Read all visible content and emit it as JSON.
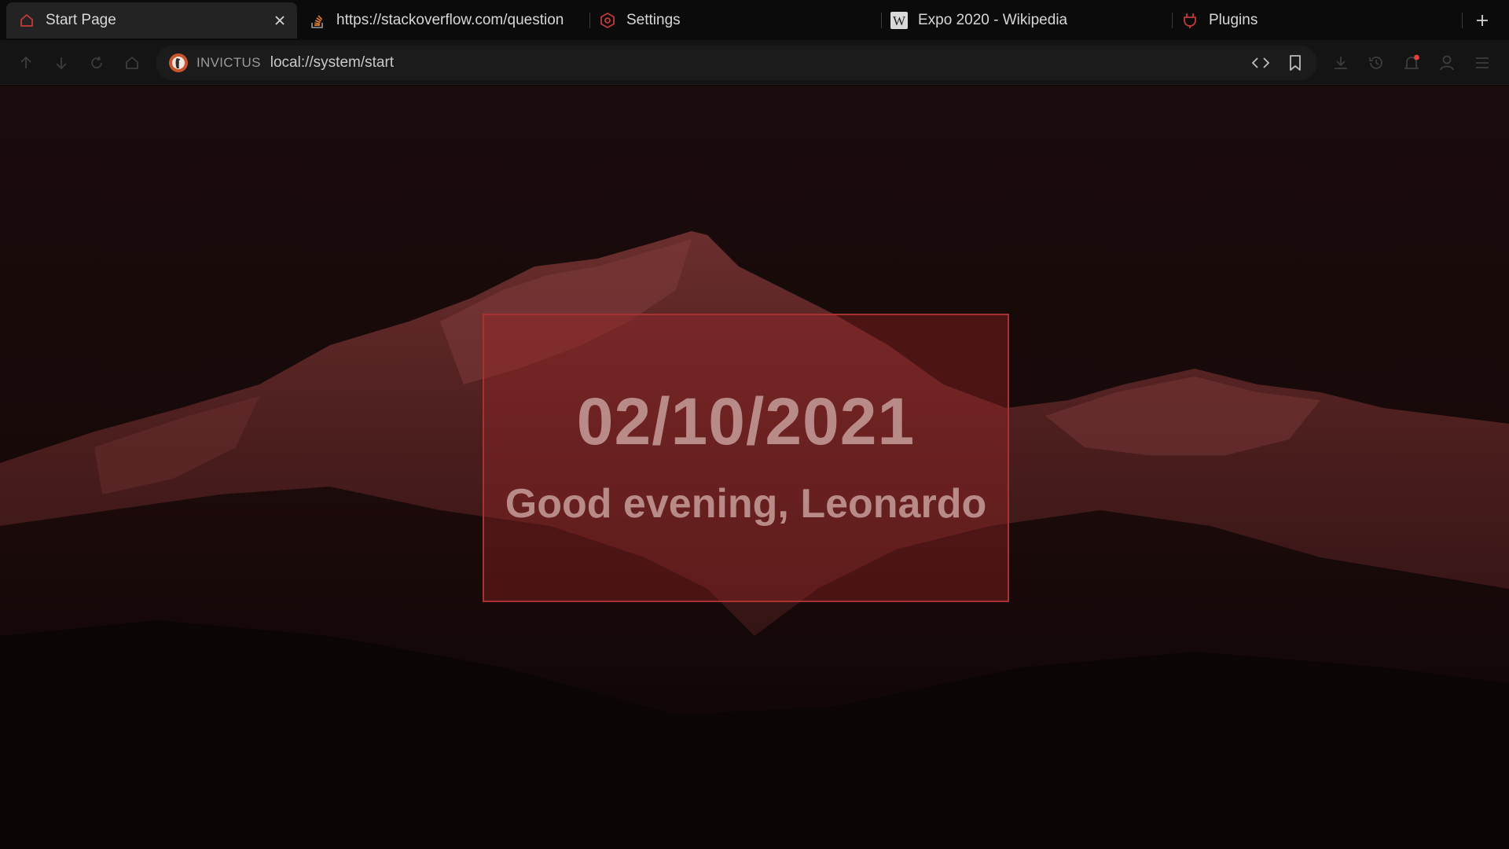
{
  "tabs": [
    {
      "label": "Start Page",
      "icon": "home-icon",
      "active": true
    },
    {
      "label": "https://stackoverflow.com/question",
      "icon": "stackoverflow-icon",
      "active": false
    },
    {
      "label": "Settings",
      "icon": "settings-hexagon-icon",
      "active": false
    },
    {
      "label": "Expo 2020 - Wikipedia",
      "icon": "wikipedia-icon",
      "active": false
    },
    {
      "label": "Plugins",
      "icon": "plug-icon",
      "active": false
    }
  ],
  "toolbar": {
    "engine_label": "INVICTUS",
    "url": "local://system/start"
  },
  "start_page": {
    "date": "02/10/2021",
    "greeting": "Good evening, Leonardo"
  },
  "colors": {
    "accent": "#c43a3a",
    "card_border": "#a83232",
    "text_muted": "#b88a88",
    "notification_dot": "#e04040"
  }
}
